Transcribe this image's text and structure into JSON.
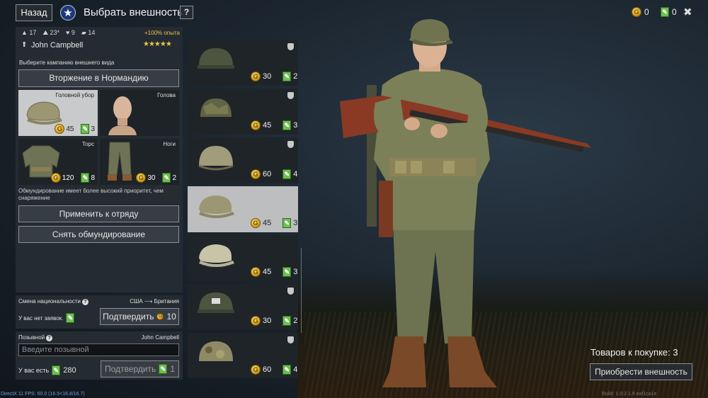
{
  "header": {
    "back_label": "Назад",
    "title": "Выбрать внешность",
    "help_label": "?",
    "gold": "0",
    "tickets": "0",
    "close_label": "✖"
  },
  "soldier": {
    "stat1": "17",
    "stat2": "23*",
    "stat3": "9",
    "stat4": "14",
    "exp_bonus": "+100% опыта",
    "name": "John Campbell",
    "stars": "★★★★★"
  },
  "appearance": {
    "campaign_label": "Выберите кампанию внешнего вида",
    "campaign": "Вторжение в Нормандию",
    "slots": [
      {
        "label": "Головной убор",
        "gold": "45",
        "tickets": "3"
      },
      {
        "label": "Голова",
        "gold": "",
        "tickets": ""
      },
      {
        "label": "Торс",
        "gold": "120",
        "tickets": "8"
      },
      {
        "label": "Ноги",
        "gold": "30",
        "tickets": "2"
      }
    ],
    "note": "Обмундирование имеет более высокий приоритет, чем снаряжение",
    "apply_label": "Применить к отряду",
    "remove_label": "Снять обмундирование"
  },
  "nationality": {
    "title": "Смена национальности",
    "change": "США ⟶ Британия",
    "status": "У вас нет заявок.",
    "confirm_label": "Подтвердить",
    "cost": "10"
  },
  "callsign": {
    "title": "Позывной",
    "current": "John Campbell",
    "placeholder": "Введите позывной",
    "have_label": "У вас есть",
    "have_count": "280",
    "confirm_label": "Подтвердить",
    "cost": "1"
  },
  "items": [
    {
      "gold": "30",
      "tickets": "2",
      "shield": true
    },
    {
      "gold": "45",
      "tickets": "3",
      "shield": true
    },
    {
      "gold": "60",
      "tickets": "4",
      "shield": true
    },
    {
      "gold": "45",
      "tickets": "3",
      "shield": false
    },
    {
      "gold": "45",
      "tickets": "3",
      "shield": false
    },
    {
      "gold": "30",
      "tickets": "2",
      "shield": true
    },
    {
      "gold": "60",
      "tickets": "4",
      "shield": true
    }
  ],
  "purchase": {
    "count_text": "Товаров к покупке: 3",
    "buy_label": "Приобрести внешность"
  },
  "footer": {
    "fps": "DirectX 11 FPS: 60.0 (16.5<16.8/16.7)",
    "build": "Build: 1.0.2.1.9 eaf1ca1e"
  }
}
